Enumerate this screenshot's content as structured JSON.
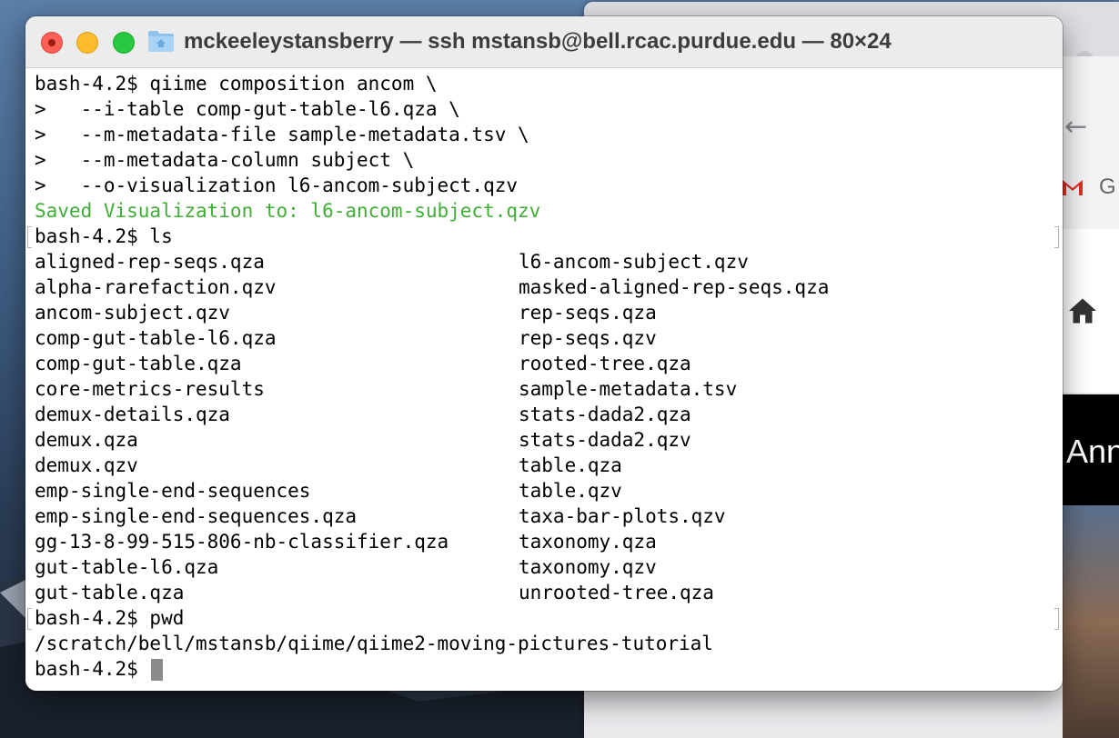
{
  "terminal": {
    "title": "mckeeleystansberry — ssh mstansb@bell.rcac.purdue.edu — 80×24",
    "command_lines": [
      "bash-4.2$ qiime composition ancom \\",
      ">   --i-table comp-gut-table-l6.qza \\",
      ">   --m-metadata-file sample-metadata.tsv \\",
      ">   --m-metadata-column subject \\",
      ">   --o-visualization l6-ancom-subject.qzv"
    ],
    "saved_line": "Saved Visualization to: l6-ancom-subject.qzv",
    "ls_prompt": "bash-4.2$ ls",
    "ls_left": [
      "aligned-rep-seqs.qza",
      "alpha-rarefaction.qzv",
      "ancom-subject.qzv",
      "comp-gut-table-l6.qza",
      "comp-gut-table.qza",
      "core-metrics-results",
      "demux-details.qza",
      "demux.qza",
      "demux.qzv",
      "emp-single-end-sequences",
      "emp-single-end-sequences.qza",
      "gg-13-8-99-515-806-nb-classifier.qza",
      "gut-table-l6.qza",
      "gut-table.qza"
    ],
    "ls_right": [
      "l6-ancom-subject.qzv",
      "masked-aligned-rep-seqs.qza",
      "rep-seqs.qza",
      "rep-seqs.qzv",
      "rooted-tree.qza",
      "sample-metadata.tsv",
      "stats-dada2.qza",
      "stats-dada2.qzv",
      "table.qza",
      "table.qzv",
      "taxa-bar-plots.qzv",
      "taxonomy.qza",
      "taxonomy.qzv",
      "unrooted-tree.qza"
    ],
    "pwd_prompt": "bash-4.2$ pwd",
    "pwd_output": "/scratch/bell/mstansb/qiime/qiime2-moving-pictures-tutorial",
    "final_prompt": "bash-4.2$ "
  },
  "background_browser": {
    "bookmark_text": "G",
    "banner_text": "Ann"
  },
  "colors": {
    "saved_text": "#3fae34",
    "close": "#fe5f57",
    "minimize": "#febc2e",
    "zoom": "#28c840"
  },
  "icons": [
    "folder-icon",
    "back-arrow-icon",
    "gmail-icon",
    "home-icon"
  ]
}
